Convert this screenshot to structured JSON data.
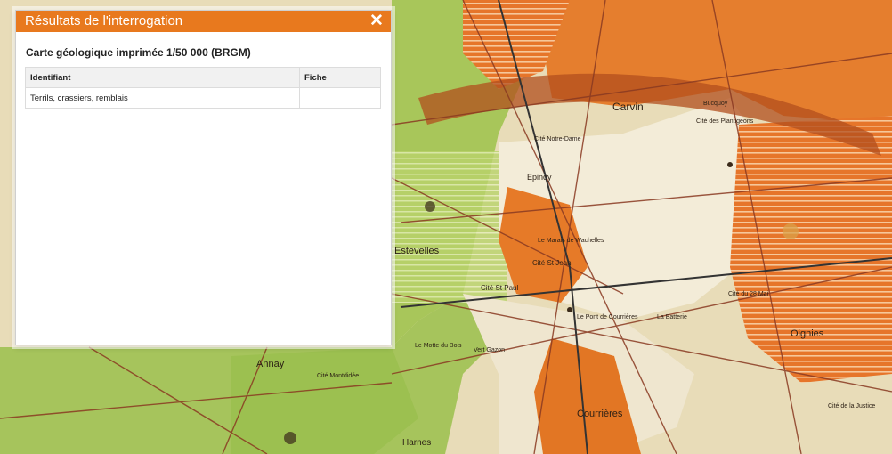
{
  "popup": {
    "title": "Résultats de l'interrogation",
    "close_icon": "close-icon",
    "layer_title": "Carte géologique imprimée 1/50 000 (BRGM)",
    "table": {
      "headers": [
        "Identifiant",
        "Fiche"
      ],
      "rows": [
        {
          "identifiant": "Terrils, crassiers, remblais",
          "fiche": ""
        }
      ]
    }
  },
  "map": {
    "places": [
      "Carvin",
      "Epinoy",
      "Estevelles",
      "Annay",
      "Courrières",
      "Oignies",
      "Harnes",
      "Cité St Paul",
      "Cité St Jean",
      "Le Pont de Courrières",
      "Cité du 28 Mai",
      "Cité des Plantigeons",
      "Cité Montdidée",
      "Le Motte du Bois",
      "Vert Gazon",
      "La Batterie",
      "Bucquoy",
      "Cité Notre-Dame",
      "Cité de la Justice",
      "Le Marais de Wachelles"
    ],
    "colors": {
      "orange": "#e8791e",
      "map_green": "#a8c65a",
      "map_pale": "#f3ecd8"
    }
  }
}
